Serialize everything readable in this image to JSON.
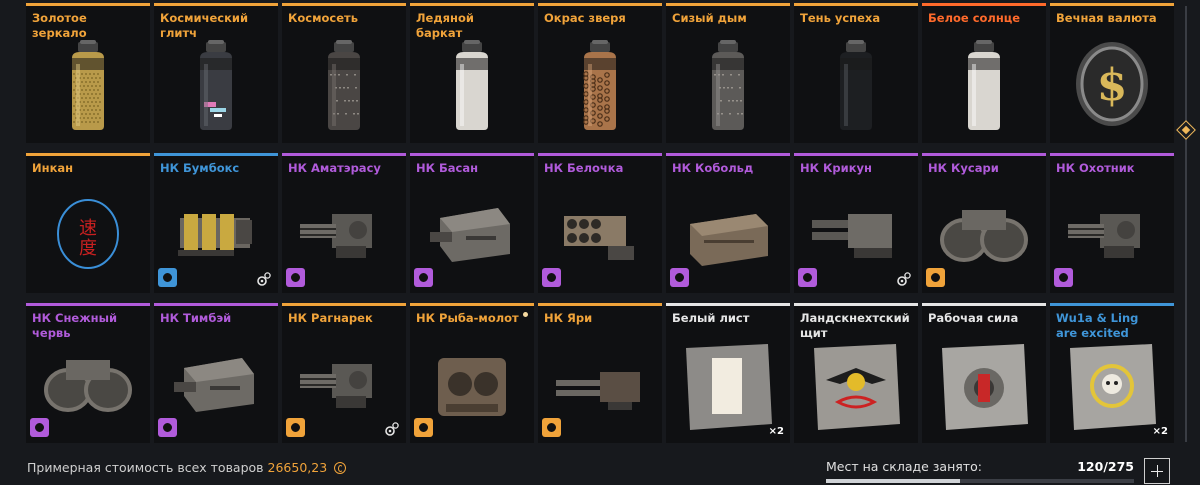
{
  "rarity_colors": {
    "legendary": "#f0a33a",
    "epic": "#b15bdb",
    "rare": "#3f95d8",
    "common": "#e6e6e6",
    "relic": "#ff6a2b"
  },
  "inventory": {
    "items": [
      {
        "name": "Золотое зеркало",
        "rarity": "legendary",
        "art": "can-gold",
        "badge": "",
        "gear": false,
        "qty": "",
        "dot": false
      },
      {
        "name": "Космический глитч",
        "rarity": "legendary",
        "art": "can-glitch",
        "badge": "",
        "gear": false,
        "qty": "",
        "dot": false
      },
      {
        "name": "Космосеть",
        "rarity": "legendary",
        "art": "can-dark",
        "badge": "",
        "gear": false,
        "qty": "",
        "dot": false
      },
      {
        "name": "Ледяной баркат",
        "rarity": "legendary",
        "art": "can-white",
        "badge": "",
        "gear": false,
        "qty": "",
        "dot": false
      },
      {
        "name": "Окрас зверя",
        "rarity": "legendary",
        "art": "can-leopard",
        "badge": "",
        "gear": false,
        "qty": "",
        "dot": false
      },
      {
        "name": "Сизый дым",
        "rarity": "legendary",
        "art": "can-smoke",
        "badge": "",
        "gear": false,
        "qty": "",
        "dot": false
      },
      {
        "name": "Тень успеха",
        "rarity": "legendary",
        "art": "can-black",
        "badge": "",
        "gear": false,
        "qty": "",
        "dot": false
      },
      {
        "name": "Белое солнце",
        "rarity": "relic",
        "art": "can-white",
        "badge": "",
        "gear": false,
        "qty": "",
        "dot": false
      },
      {
        "name": "Вечная валюта",
        "rarity": "legendary",
        "art": "coin-dollar",
        "badge": "",
        "gear": false,
        "qty": "",
        "dot": false
      },
      {
        "name": "Инкан",
        "rarity": "legendary",
        "art": "stamp",
        "badge": "",
        "gear": false,
        "qty": "",
        "dot": false
      },
      {
        "name": "НК Бумбокс",
        "rarity": "rare",
        "art": "weapon-boombox",
        "badge": "rare",
        "gear": true,
        "qty": "",
        "dot": false
      },
      {
        "name": "НК Аматэрасу",
        "rarity": "epic",
        "art": "weapon-gatling",
        "badge": "epic",
        "gear": false,
        "qty": "",
        "dot": false
      },
      {
        "name": "НК Басан",
        "rarity": "epic",
        "art": "weapon-block",
        "badge": "epic",
        "gear": false,
        "qty": "",
        "dot": false
      },
      {
        "name": "НК Белочка",
        "rarity": "epic",
        "art": "weapon-launcher",
        "badge": "epic",
        "gear": false,
        "qty": "",
        "dot": false
      },
      {
        "name": "НК Кобольд",
        "rarity": "epic",
        "art": "weapon-crate",
        "badge": "epic",
        "gear": false,
        "qty": "",
        "dot": false
      },
      {
        "name": "НК Крикун",
        "rarity": "epic",
        "art": "weapon-twin",
        "badge": "epic",
        "gear": true,
        "qty": "",
        "dot": false
      },
      {
        "name": "НК Кусари",
        "rarity": "epic",
        "art": "weapon-tracks",
        "badge": "legendary",
        "gear": false,
        "qty": "",
        "dot": false
      },
      {
        "name": "НК Охотник",
        "rarity": "epic",
        "art": "weapon-gatling",
        "badge": "epic",
        "gear": false,
        "qty": "",
        "dot": false
      },
      {
        "name": "НК Снежный червь",
        "rarity": "epic",
        "art": "weapon-tracks",
        "badge": "epic",
        "gear": false,
        "qty": "",
        "dot": false
      },
      {
        "name": "НК Тимбэй",
        "rarity": "epic",
        "art": "weapon-block",
        "badge": "epic",
        "gear": false,
        "qty": "",
        "dot": false
      },
      {
        "name": "НК Рагнарек",
        "rarity": "legendary",
        "art": "weapon-gatling",
        "badge": "legendary",
        "gear": true,
        "qty": "",
        "dot": false
      },
      {
        "name": "НК Рыба-молот",
        "rarity": "legendary",
        "art": "weapon-engine",
        "badge": "legendary",
        "gear": false,
        "qty": "",
        "dot": true
      },
      {
        "name": "НК Яри",
        "rarity": "legendary",
        "art": "weapon-rail",
        "badge": "legendary",
        "gear": false,
        "qty": "",
        "dot": false
      },
      {
        "name": "Белый лист",
        "rarity": "common",
        "art": "sticker-blank",
        "badge": "",
        "gear": false,
        "qty": "×2",
        "dot": false
      },
      {
        "name": "Ландскнехтский щит",
        "rarity": "common",
        "art": "sticker-eagle",
        "badge": "",
        "gear": false,
        "qty": "",
        "dot": false
      },
      {
        "name": "Рабочая сила",
        "rarity": "common",
        "art": "sticker-gear",
        "badge": "",
        "gear": false,
        "qty": "",
        "dot": false
      },
      {
        "name": "Wu1a & Ling are excited",
        "rarity": "rare",
        "art": "sticker-skull",
        "badge": "",
        "gear": false,
        "qty": "×2",
        "dot": false
      }
    ]
  },
  "footer": {
    "total_label": "Примерная стоимость всех товаров",
    "total_value": "26650,23",
    "storage_label": "Мест на складе занято:",
    "storage_count": "120/275",
    "storage_fraction": 0.436
  }
}
